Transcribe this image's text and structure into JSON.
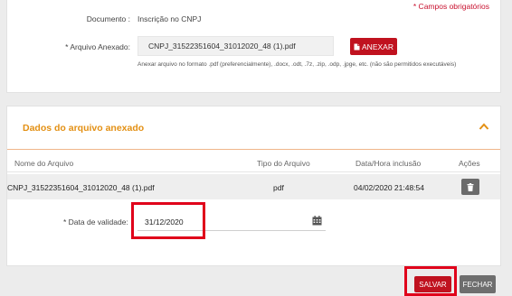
{
  "form": {
    "required_note": "* Campos obrigatórios",
    "documento_label": "Documento :",
    "documento_value": "Inscrição no CNPJ",
    "arquivo_label": "* Arquivo Anexado:",
    "arquivo_value": "CNPJ_31522351604_31012020_48 (1).pdf",
    "anexar_label": "ANEXAR",
    "hint": "Anexar arquivo no formato .pdf (preferencialmente), .docx, .odt, .7z, .zip, .odp, .jpge, etc. (não são permitidos executáveis)"
  },
  "attachments": {
    "section_title": "Dados do arquivo anexado",
    "columns": [
      "Nome do Arquivo",
      "Tipo do Arquivo",
      "Data/Hora inclusão",
      "Ações"
    ],
    "rows": [
      {
        "nome": "CNPJ_31522351604_31012020_48 (1).pdf",
        "tipo": "pdf",
        "data": "04/02/2020 21:48:54"
      }
    ],
    "validade_label": "* Data de validade:",
    "validade_value": "31/12/2020"
  },
  "footer": {
    "salvar_label": "SALVAR",
    "fechar_label": "FECHAR"
  },
  "colors": {
    "accent_red": "#c0121f",
    "section_orange": "#e39014",
    "highlight_red": "#e0001a"
  },
  "icons": [
    "file-icon",
    "chevron-up-icon",
    "trash-icon",
    "calendar-icon"
  ]
}
